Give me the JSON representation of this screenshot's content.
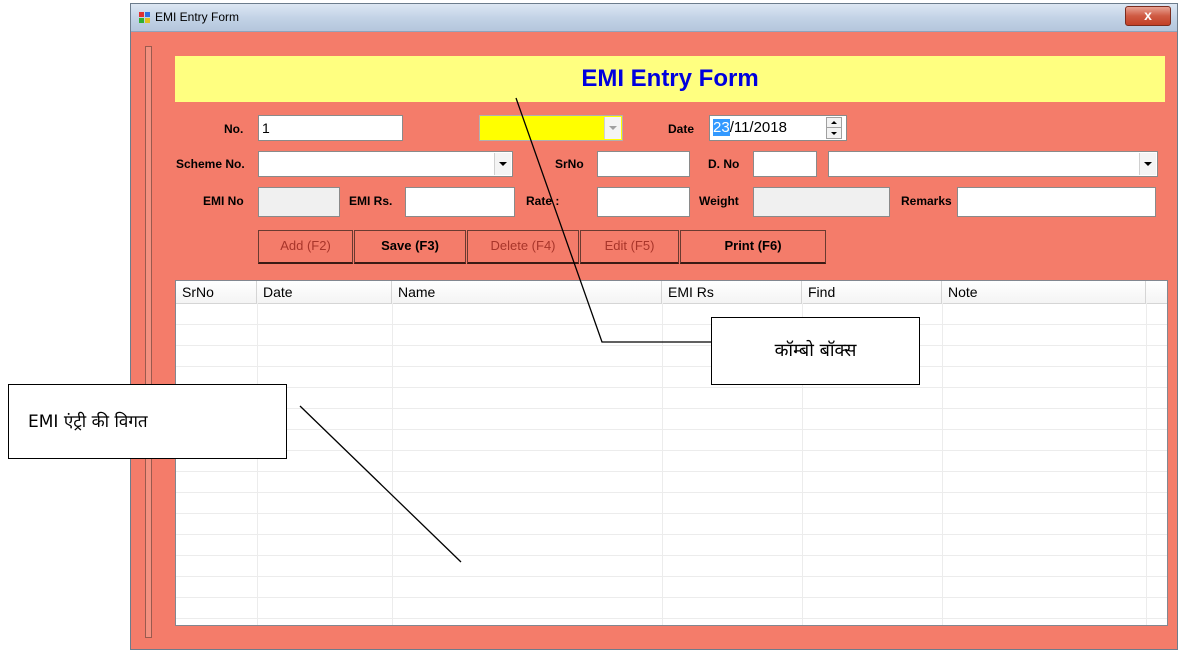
{
  "window": {
    "title": "EMI Entry Form",
    "close_label": "x"
  },
  "form": {
    "heading": "EMI Entry Form",
    "labels": {
      "no": "No.",
      "date": "Date",
      "scheme_no": "Scheme No.",
      "srno": "SrNo",
      "d_no": "D. No",
      "emi_no": "EMI No",
      "emi_rs": "EMI Rs.",
      "rate": "Rate :",
      "weight": "Weight",
      "remarks": "Remarks"
    },
    "values": {
      "no": "1",
      "date_day": "23",
      "date_rest": "/11/2018",
      "scheme_no": "",
      "srno": "",
      "d_no": "",
      "d_combo": "",
      "emi_no": "",
      "emi_rs": "",
      "rate": "",
      "weight": "",
      "remarks": "",
      "combo": ""
    }
  },
  "buttons": {
    "add": "Add (F2)",
    "save": "Save (F3)",
    "delete": "Delete (F4)",
    "edit": "Edit (F5)",
    "print": "Print (F6)"
  },
  "grid": {
    "columns": [
      "SrNo",
      "Date",
      "Name",
      "EMI Rs",
      "Find",
      "Note"
    ]
  },
  "annotations": {
    "combo_box": "कॉम्बो बॉक्स",
    "emi_entry_detail": "EMI एंट्री की विगत"
  },
  "colors": {
    "form_bg": "#f47c6a",
    "banner_bg": "#ffff80",
    "heading": "#0000dd",
    "combo_bg": "#ffff00"
  }
}
